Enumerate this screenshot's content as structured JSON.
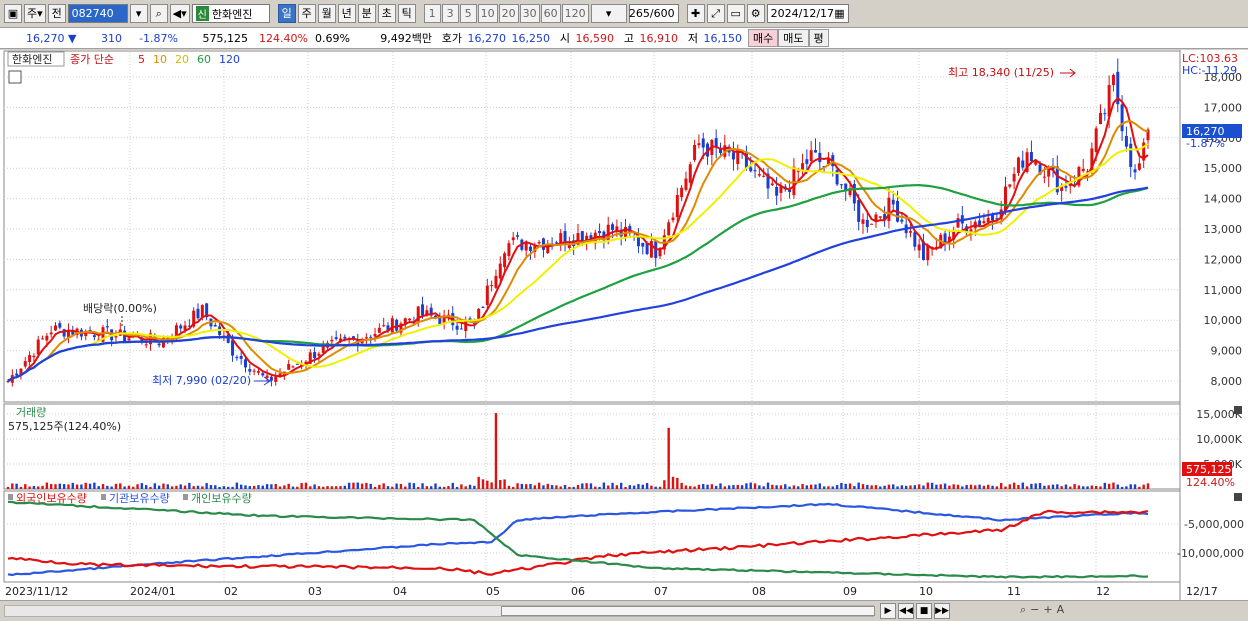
{
  "toolbar": {
    "type_label": "주",
    "prev_label": "전",
    "code": "082740",
    "stock_name": "한화엔진",
    "sin_label": "신",
    "periods": [
      "일",
      "주",
      "월",
      "년",
      "분",
      "초",
      "틱"
    ],
    "active_period": "일",
    "intervals": [
      "1",
      "3",
      "5",
      "10",
      "20",
      "30",
      "60",
      "120"
    ],
    "page_count": "265",
    "page_total": "600",
    "date": "2024/12/17"
  },
  "quote": {
    "price": "16,270",
    "change": "310",
    "change_pct": "-1.87%",
    "volume": "575,125",
    "vol_ratio": "124.40%",
    "turnover_pct": "0.69%",
    "amount": "9,492백만",
    "hoga_label": "호가",
    "ask": "16,270",
    "bid": "16,250",
    "open_label": "시",
    "open": "16,590",
    "high_label": "고",
    "high": "16,910",
    "low_label": "저",
    "low": "16,150",
    "buy_label": "매수",
    "sell_label": "매도",
    "avg_label": "평"
  },
  "legend": {
    "stock": "한화엔진",
    "ma_label": "종가 단순",
    "ma_periods": [
      "5",
      "10",
      "20",
      "60",
      "120"
    ],
    "ma_colors": [
      "#e01010",
      "#e08a00",
      "#f0f000",
      "#20a040",
      "#2040e0"
    ]
  },
  "price_axis": [
    "18,000",
    "17,000",
    "16,000",
    "15,000",
    "14,000",
    "13,000",
    "12,000",
    "11,000",
    "10,000",
    "9,000",
    "8,000"
  ],
  "price_panel": {
    "lc": "LC:103.63",
    "hc": "HC:-11.29",
    "current": "16,270",
    "current_pct": "-1.87%"
  },
  "annotations": {
    "high": "최고 18,340 (11/25)",
    "low": "최저 7,990 (02/20)",
    "dividend": "배당락(0.00%)"
  },
  "volume_panel": {
    "title": "거래량",
    "value": "575,125주(124.40%)",
    "axis": [
      "15,000K",
      "10,000K",
      "5,000K"
    ],
    "current": "575,125",
    "current_pct": "124.40%"
  },
  "holding_panel": {
    "series": [
      "외국인보유수량",
      "기관보유수량",
      "개인보유수량"
    ],
    "colors": [
      "#e01010",
      "#2a56e0",
      "#2a8a4a"
    ],
    "axis": [
      "-5,000,000",
      "-10,000,000"
    ]
  },
  "x_axis": [
    "2023/11/12",
    "2024/01",
    "02",
    "03",
    "04",
    "05",
    "06",
    "07",
    "08",
    "09",
    "10",
    "11",
    "12",
    "12/17"
  ],
  "colors": {
    "up": "#e01010",
    "down": "#1a3fd0",
    "grid": "#d0d0d0"
  }
}
